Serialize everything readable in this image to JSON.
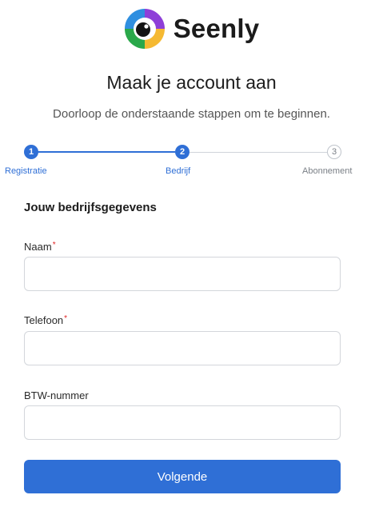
{
  "brand": {
    "name": "Seenly",
    "logo_icon": "seenly-eye-logo"
  },
  "header": {
    "title": "Maak je account aan",
    "subtitle": "Doorloop de onderstaande stappen om te beginnen."
  },
  "stepper": {
    "steps": [
      {
        "number": "1",
        "label": "Registratie",
        "state": "completed"
      },
      {
        "number": "2",
        "label": "Bedrijf",
        "state": "active"
      },
      {
        "number": "3",
        "label": "Abonnement",
        "state": "upcoming"
      }
    ]
  },
  "form": {
    "section_title": "Jouw bedrijfsgegevens",
    "fields": [
      {
        "label": "Naam",
        "required_mark": "*",
        "value": ""
      },
      {
        "label": "Telefoon",
        "required_mark": "*",
        "value": ""
      },
      {
        "label": "BTW-nummer",
        "value": ""
      }
    ],
    "submit_label": "Volgende"
  },
  "colors": {
    "accent": "#2f6fd6",
    "required": "#e02424"
  }
}
